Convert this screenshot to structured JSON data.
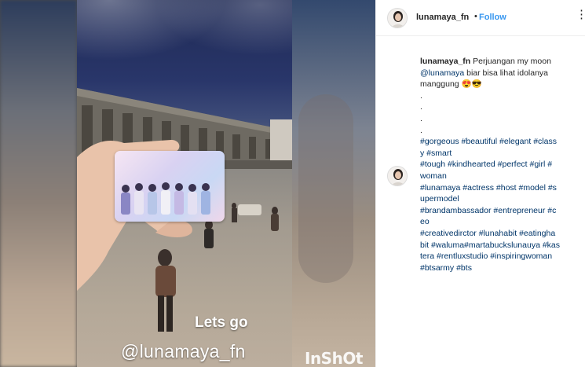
{
  "post": {
    "username": "lunamaya_fn",
    "separator": "•",
    "follow_label": "Follow",
    "more_icon": "more-options-icon"
  },
  "media": {
    "overlay_text_1": "Lets go",
    "overlay_text_2": "@lunamaya_fn",
    "watermark": "InShOt"
  },
  "caption": {
    "username": "lunamaya_fn",
    "text_1": "Perjuangan my moon",
    "mention": "@lunamaya",
    "text_2": "biar bisa lihat idolanya manggung",
    "emoji": "😍😎",
    "dots": [
      ".",
      ".",
      ".",
      "."
    ],
    "hashtag_lines": [
      "#gorgeous #beautiful #elegant #class",
      "y #smart",
      "#tough #kindhearted #perfect #girl #",
      "woman",
      "#lunamaya #actress #host #model #s",
      "upermodel",
      "#brandambassador #entrepreneur #c",
      "eo",
      "#creativedirctor #lunahabit #eatingha",
      "bit #waluma#martabuckslunauya #kas",
      "tera #rentluxstudio #inspiringwoman",
      "#btsarmy #bts"
    ]
  },
  "colors": {
    "link": "#003569",
    "follow": "#3897f0",
    "text": "#262626"
  }
}
